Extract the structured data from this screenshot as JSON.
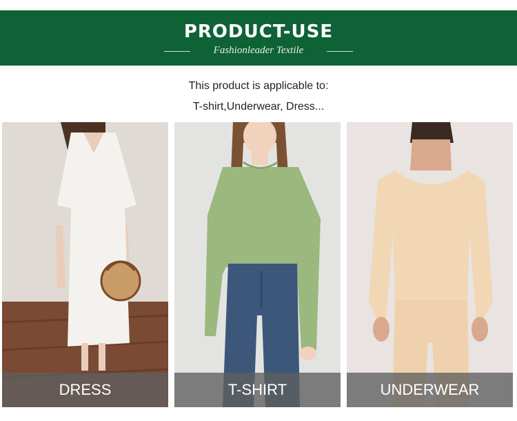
{
  "header": {
    "title": "PRODUCT-USE",
    "subtitle": "Fashionleader Textile",
    "background_color": "#0f6236"
  },
  "intro": {
    "line1": "This product is applicable to:",
    "line2": "T-shirt,Underwear,  Dress..."
  },
  "products": [
    {
      "label": "DRESS"
    },
    {
      "label": "T-SHIRT"
    },
    {
      "label": "UNDERWEAR"
    }
  ]
}
